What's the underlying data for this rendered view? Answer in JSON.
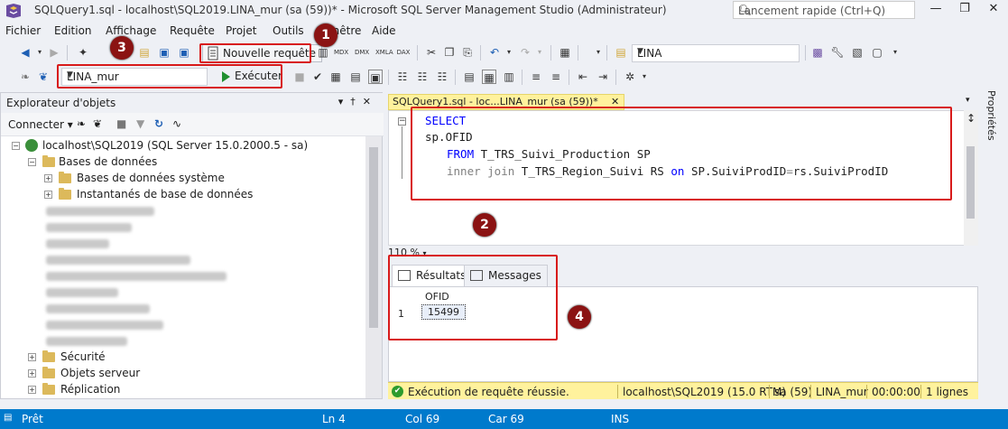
{
  "window": {
    "title": "SQLQuery1.sql - localhost\\SQL2019.LINA_mur (sa (59))* - Microsoft SQL Server Management Studio (Administrateur)",
    "quick_launch_placeholder": "Lancement rapide (Ctrl+Q)"
  },
  "menu": [
    "Fichier",
    "Edition",
    "Affichage",
    "Requête",
    "Projet",
    "Outils",
    "Fenêtre",
    "Aide"
  ],
  "toolbar": {
    "new_query_label": "Nouvelle requête",
    "server_value": "LINA",
    "database_value": "LINA_mur",
    "execute_label": "Exécuter"
  },
  "annotations": [
    "1",
    "2",
    "3",
    "4"
  ],
  "object_explorer": {
    "title": "Explorateur d'objets",
    "connect_label": "Connecter",
    "server_node": "localhost\\SQL2019 (SQL Server 15.0.2000.5 - sa)",
    "databases_label": "Bases de données",
    "system_databases_label": "Bases de données système",
    "snapshots_label": "Instantanés de base de données",
    "bottom_nodes": [
      "Sécurité",
      "Objets serveur",
      "Réplication"
    ]
  },
  "editor": {
    "tab_title": "SQLQuery1.sql - loc...LINA_mur (sa (59))*",
    "zoom": "110 %",
    "lines": {
      "select": "SELECT",
      "column": "sp.OFID",
      "from_kw": "FROM",
      "from_obj": "T_TRS_Suivi_Production SP",
      "join_kw": "inner join",
      "join_obj": "T_TRS_Region_Suivi RS",
      "on_kw": "on",
      "on_expr_left": "SP.SuiviProdID",
      "on_eq": "=",
      "on_expr_right": "rs.SuiviProdID"
    }
  },
  "results": {
    "tabs": [
      "Résultats",
      "Messages"
    ],
    "columns": [
      "OFID"
    ],
    "rows": [
      {
        "num": "1",
        "OFID": "15499"
      }
    ]
  },
  "query_status": {
    "message": "Exécution de requête réussie.",
    "server": "localhost\\SQL2019 (15.0 RTM)",
    "user": "sa (59)",
    "database": "LINA_mur",
    "elapsed": "00:00:00",
    "rows": "1 lignes"
  },
  "properties_label": "Propriétés",
  "statusbar": {
    "ready": "Prêt",
    "ln": "Ln 4",
    "col": "Col 69",
    "ch": "Car 69",
    "ins": "INS"
  },
  "colors": {
    "accent_blue": "#007acc",
    "annotation_red": "#d81a1a",
    "tab_yellow": "#fff29d"
  }
}
